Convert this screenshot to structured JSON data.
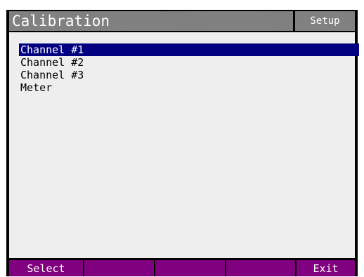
{
  "header": {
    "title": "Calibration",
    "mode_label": "Setup"
  },
  "menu": {
    "selected_index": 0,
    "items": [
      {
        "label": "Channel #1"
      },
      {
        "label": "Channel #2"
      },
      {
        "label": "Channel #3"
      },
      {
        "label": "Meter"
      }
    ]
  },
  "softkeys": [
    {
      "label": "Select"
    },
    {
      "label": ""
    },
    {
      "label": ""
    },
    {
      "label": ""
    },
    {
      "label": "Exit"
    }
  ],
  "colors": {
    "title_bar": "#7c7c7c",
    "selection": "#000080",
    "softkey": "#800080",
    "content_background": "#eeeeee",
    "frame": "#000000"
  }
}
